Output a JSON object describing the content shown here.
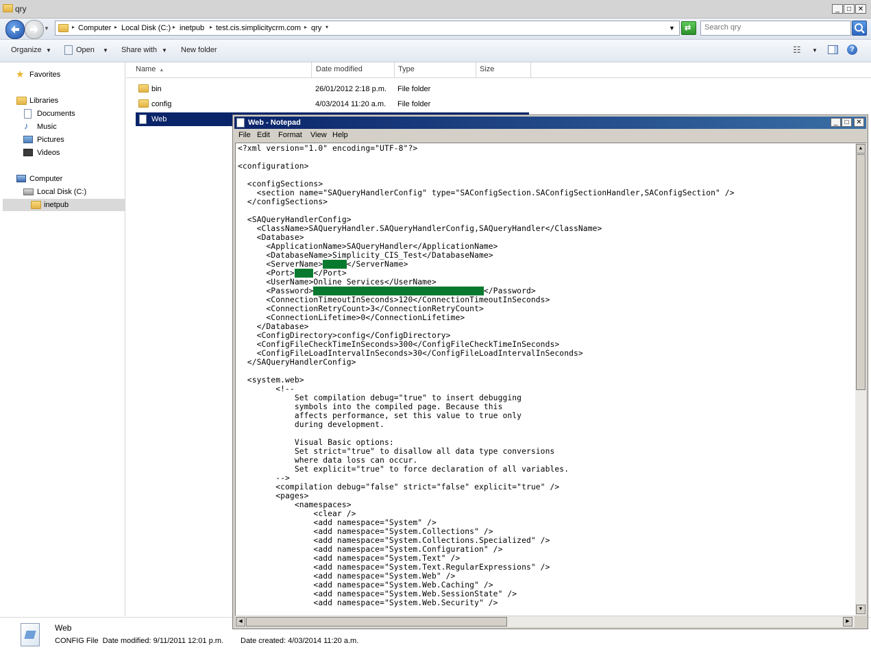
{
  "explorer": {
    "title": "qry",
    "breadcrumbs": [
      "Computer",
      "Local Disk (C:)",
      "inetpub",
      "test.cis.simplicitycrm.com",
      "qry"
    ],
    "search_placeholder": "Search qry",
    "toolbar": {
      "organize": "Organize",
      "open": "Open",
      "share_with": "Share with",
      "new_folder": "New folder"
    },
    "nav": {
      "favorites": "Favorites",
      "libraries": "Libraries",
      "documents": "Documents",
      "music": "Music",
      "pictures": "Pictures",
      "videos": "Videos",
      "computer": "Computer",
      "local_disk": "Local Disk (C:)",
      "inetpub": "inetpub"
    },
    "columns": [
      "Name",
      "Date modified",
      "Type",
      "Size"
    ],
    "files": [
      {
        "name": "bin",
        "date": "26/01/2012 2:18 p.m.",
        "type": "File folder"
      },
      {
        "name": "config",
        "date": "4/03/2014 11:20 a.m.",
        "type": "File folder"
      },
      {
        "name": "Web",
        "date": "",
        "type": ""
      }
    ],
    "details": {
      "name": "Web",
      "meta": "CONFIG File  Date modified: 9/11/2011 12:01 p.m.",
      "created": "Date created: 4/03/2014 11:20 a.m."
    }
  },
  "notepad": {
    "title": "Web - Notepad",
    "menu": [
      "File",
      "Edit",
      "Format",
      "View",
      "Help"
    ],
    "code_lines": {
      "l1": "<?xml version=\"1.0\" encoding=\"UTF-8\"?>",
      "l2": "<configuration>",
      "l3": "  <configSections>",
      "l4": "    <section name=\"SAQueryHandlerConfig\" type=\"SAConfigSection.SAConfigSectionHandler,SAConfigSection\" />",
      "l5": "  </configSections>",
      "l6": "  <SAQueryHandlerConfig>",
      "l7": "    <ClassName>SAQueryHandler.SAQueryHandlerConfig,SAQueryHandler</ClassName>",
      "l8": "    <Database>",
      "l9": "      <ApplicationName>SAQueryHandler</ApplicationName>",
      "l10": "      <DatabaseName>Simplicity_CIS_Test</DatabaseName>",
      "l11a": "      <ServerName>",
      "l11b": "</ServerName>",
      "l12a": "      <Port>",
      "l12b": "</Port>",
      "l13": "      <UserName>Online Services</UserName>",
      "l14a": "      <Password>",
      "l14b": "</Password>",
      "l15": "      <ConnectionTimeoutInSeconds>120</ConnectionTimeoutInSeconds>",
      "l16": "      <ConnectionRetryCount>3</ConnectionRetryCount>",
      "l17": "      <ConnectionLifetime>0</ConnectionLifetime>",
      "l18": "    </Database>",
      "l19": "    <ConfigDirectory>config</ConfigDirectory>",
      "l20": "    <ConfigFileCheckTimeInSeconds>300</ConfigFileCheckTimeInSeconds>",
      "l21": "    <ConfigFileLoadIntervalInSeconds>30</ConfigFileLoadIntervalInSeconds>",
      "l22": "  </SAQueryHandlerConfig>",
      "l23": "  <system.web>",
      "l24": "        <!--",
      "l25": "            Set compilation debug=\"true\" to insert debugging",
      "l26": "            symbols into the compiled page. Because this",
      "l27": "            affects performance, set this value to true only",
      "l28": "            during development.",
      "l29": "            Visual Basic options:",
      "l30": "            Set strict=\"true\" to disallow all data type conversions",
      "l31": "            where data loss can occur.",
      "l32": "            Set explicit=\"true\" to force declaration of all variables.",
      "l33": "        -->",
      "l34": "        <compilation debug=\"false\" strict=\"false\" explicit=\"true\" />",
      "l35": "        <pages>",
      "l36": "            <namespaces>",
      "l37": "                <clear />",
      "l38": "                <add namespace=\"System\" />",
      "l39": "                <add namespace=\"System.Collections\" />",
      "l40": "                <add namespace=\"System.Collections.Specialized\" />",
      "l41": "                <add namespace=\"System.Configuration\" />",
      "l42": "                <add namespace=\"System.Text\" />",
      "l43": "                <add namespace=\"System.Text.RegularExpressions\" />",
      "l44": "                <add namespace=\"System.Web\" />",
      "l45": "                <add namespace=\"System.Web.Caching\" />",
      "l46": "                <add namespace=\"System.Web.SessionState\" />",
      "l47": "                <add namespace=\"System.Web.Security\" />"
    },
    "redaction_color": "#087a30"
  }
}
